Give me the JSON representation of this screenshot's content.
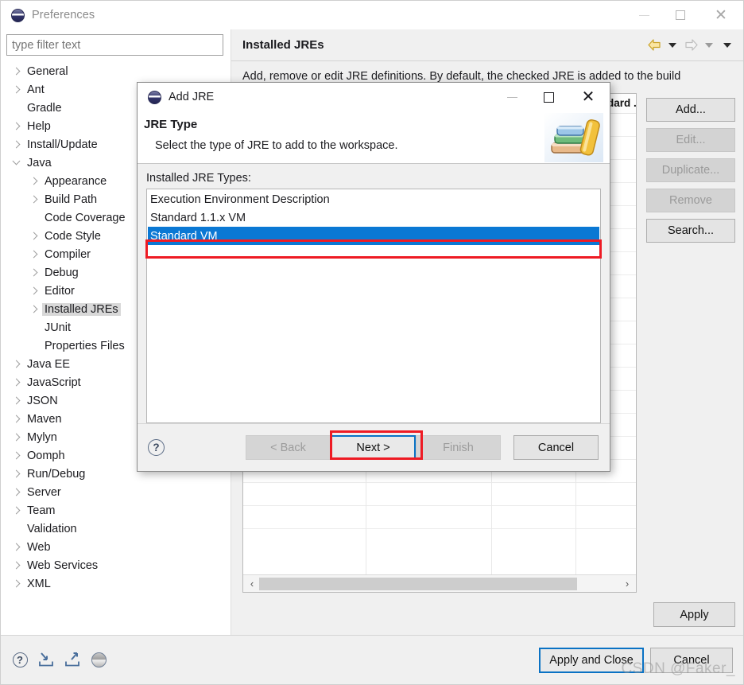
{
  "window": {
    "title": "Preferences",
    "icon": "eclipse-icon",
    "controls": {
      "minimize": "—",
      "maximize": "□",
      "close": "✕"
    }
  },
  "filter": {
    "placeholder": "type filter text",
    "value": ""
  },
  "tree": {
    "items": [
      {
        "label": "General",
        "depth": 1,
        "expandable": true,
        "expanded": false,
        "selected": false
      },
      {
        "label": "Ant",
        "depth": 1,
        "expandable": true,
        "expanded": false,
        "selected": false
      },
      {
        "label": "Gradle",
        "depth": 1,
        "expandable": false,
        "expanded": false,
        "selected": false
      },
      {
        "label": "Help",
        "depth": 1,
        "expandable": true,
        "expanded": false,
        "selected": false
      },
      {
        "label": "Install/Update",
        "depth": 1,
        "expandable": true,
        "expanded": false,
        "selected": false
      },
      {
        "label": "Java",
        "depth": 1,
        "expandable": true,
        "expanded": true,
        "selected": false
      },
      {
        "label": "Appearance",
        "depth": 2,
        "expandable": true,
        "expanded": false,
        "selected": false
      },
      {
        "label": "Build Path",
        "depth": 2,
        "expandable": true,
        "expanded": false,
        "selected": false
      },
      {
        "label": "Code Coverage",
        "depth": 2,
        "expandable": false,
        "expanded": false,
        "selected": false
      },
      {
        "label": "Code Style",
        "depth": 2,
        "expandable": true,
        "expanded": false,
        "selected": false
      },
      {
        "label": "Compiler",
        "depth": 2,
        "expandable": true,
        "expanded": false,
        "selected": false
      },
      {
        "label": "Debug",
        "depth": 2,
        "expandable": true,
        "expanded": false,
        "selected": false
      },
      {
        "label": "Editor",
        "depth": 2,
        "expandable": true,
        "expanded": false,
        "selected": false
      },
      {
        "label": "Installed JREs",
        "depth": 2,
        "expandable": true,
        "expanded": false,
        "selected": true
      },
      {
        "label": "JUnit",
        "depth": 2,
        "expandable": false,
        "expanded": false,
        "selected": false
      },
      {
        "label": "Properties Files",
        "depth": 2,
        "expandable": false,
        "expanded": false,
        "selected": false
      },
      {
        "label": "Java EE",
        "depth": 1,
        "expandable": true,
        "expanded": false,
        "selected": false
      },
      {
        "label": "JavaScript",
        "depth": 1,
        "expandable": true,
        "expanded": false,
        "selected": false
      },
      {
        "label": "JSON",
        "depth": 1,
        "expandable": true,
        "expanded": false,
        "selected": false
      },
      {
        "label": "Maven",
        "depth": 1,
        "expandable": true,
        "expanded": false,
        "selected": false
      },
      {
        "label": "Mylyn",
        "depth": 1,
        "expandable": true,
        "expanded": false,
        "selected": false
      },
      {
        "label": "Oomph",
        "depth": 1,
        "expandable": true,
        "expanded": false,
        "selected": false
      },
      {
        "label": "Run/Debug",
        "depth": 1,
        "expandable": true,
        "expanded": false,
        "selected": false
      },
      {
        "label": "Server",
        "depth": 1,
        "expandable": true,
        "expanded": false,
        "selected": false
      },
      {
        "label": "Team",
        "depth": 1,
        "expandable": true,
        "expanded": false,
        "selected": false
      },
      {
        "label": "Validation",
        "depth": 1,
        "expandable": false,
        "expanded": false,
        "selected": false
      },
      {
        "label": "Web",
        "depth": 1,
        "expandable": true,
        "expanded": false,
        "selected": false
      },
      {
        "label": "Web Services",
        "depth": 1,
        "expandable": true,
        "expanded": false,
        "selected": false
      },
      {
        "label": "XML",
        "depth": 1,
        "expandable": true,
        "expanded": false,
        "selected": false
      }
    ]
  },
  "page": {
    "title": "Installed JREs",
    "description": "Add, remove or edit JRE definitions. By default, the checked JRE is added to the build",
    "nav": {
      "back_icon": "back-arrow-icon",
      "back_menu_icon": "caret-down-icon",
      "forward_icon": "forward-arrow-icon",
      "forward_menu_icon": "caret-down-icon",
      "view_menu_icon": "caret-down-icon"
    },
    "table": {
      "column_header": "dard ..",
      "scrollbar": {
        "left_arrow": "‹",
        "right_arrow": "›"
      }
    },
    "buttons": [
      {
        "label": "Add...",
        "enabled": true
      },
      {
        "label": "Edit...",
        "enabled": false
      },
      {
        "label": "Duplicate...",
        "enabled": false
      },
      {
        "label": "Remove",
        "enabled": false
      },
      {
        "label": "Search...",
        "enabled": true
      }
    ],
    "apply_label": "Apply"
  },
  "bottom": {
    "help_icon": "question-mark-icon",
    "import_icon": "import-icon",
    "export_icon": "export-icon",
    "status_icon": "eclipse-gray-icon",
    "apply_and_close_label": "Apply and Close",
    "cancel_label": "Cancel",
    "watermark": "CSDN @Faker_"
  },
  "dialog": {
    "title": "Add JRE",
    "icon": "eclipse-icon",
    "controls": {
      "minimize": "—",
      "maximize": "□",
      "close": "✕"
    },
    "heading": "JRE Type",
    "description": "Select the type of JRE to add to the workspace.",
    "banner_icon": "books-icon",
    "list_label": "Installed JRE Types:",
    "list_items": [
      {
        "label": "Execution Environment Description",
        "selected": false
      },
      {
        "label": "Standard 1.1.x VM",
        "selected": false
      },
      {
        "label": "Standard VM",
        "selected": true
      }
    ],
    "help_icon": "question-mark-icon",
    "buttons": [
      {
        "label": "< Back",
        "enabled": false,
        "focused": false
      },
      {
        "label": "Next >",
        "enabled": true,
        "focused": true
      },
      {
        "label": "Finish",
        "enabled": false,
        "focused": false
      },
      {
        "label": "Cancel",
        "enabled": true,
        "focused": false
      }
    ]
  },
  "annotations": {
    "accent_red": "#ee1b24",
    "accent_blue": "#0a78d4",
    "focus_blue": "#0a72c4"
  }
}
